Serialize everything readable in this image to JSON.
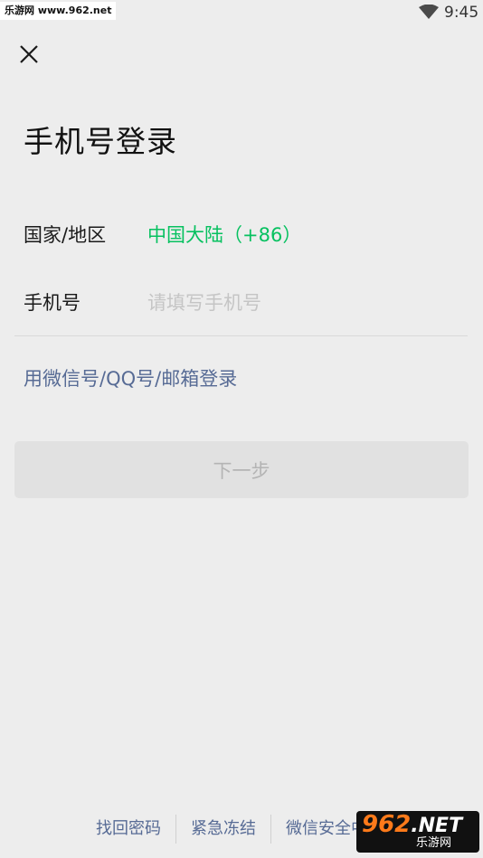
{
  "status_bar": {
    "watermark": "乐游网 www.962.net",
    "time": "9:45"
  },
  "header": {
    "close_icon": "close-icon"
  },
  "page_title": "手机号登录",
  "form": {
    "region_label": "国家/地区",
    "region_value": "中国大陆（+86）",
    "phone_label": "手机号",
    "phone_value": "",
    "phone_placeholder": "请填写手机号"
  },
  "alt_login_link": "用微信号/QQ号/邮箱登录",
  "next_button": "下一步",
  "footer": {
    "links": [
      "找回密码",
      "紧急冻结",
      "微信安全中心"
    ]
  },
  "corner_logo": {
    "number": "962",
    "suffix": ".NET",
    "caption": "乐游网"
  },
  "colors": {
    "background": "#ededed",
    "accent_green": "#07c160",
    "link_blue": "#576b95",
    "button_disabled_bg": "#e1e1e1",
    "button_disabled_text": "#b4b4b4"
  }
}
